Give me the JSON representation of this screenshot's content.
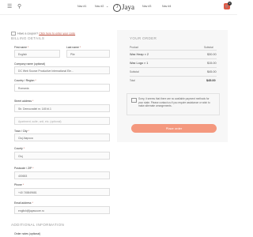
{
  "header": {
    "nav": [
      "Nav #1",
      "Nav #2",
      "Nav #3",
      "Nav #4"
    ],
    "logo": "Jaya",
    "cart_count": "0"
  },
  "coupon": {
    "prefix": "Have a coupon?",
    "link": "Click here to enter your code"
  },
  "billing": {
    "title": "BILLING DETAILS",
    "first_name": {
      "label": "First name",
      "value": "English"
    },
    "last_name": {
      "label": "Last name",
      "value": "Plie"
    },
    "company": {
      "label": "Company name (optional)",
      "value": "DC Web Source Productive International Ele..."
    },
    "country": {
      "label": "Country / Region",
      "value": "Romania"
    },
    "street": {
      "label": "Street address",
      "value": "Str. Democratiei nr. 145 bl.1",
      "placeholder2": "Apartment, suite, unit, etc. (optional)"
    },
    "city": {
      "label": "Town / City",
      "value": "Cluj-Napoca"
    },
    "county": {
      "label": "County",
      "value": "Cluj"
    },
    "postcode": {
      "label": "Postcode / ZIP",
      "value": "400653"
    },
    "phone": {
      "label": "Phone",
      "value": "+40 745849681"
    },
    "email": {
      "label": "Email address",
      "value": "english@jayasoure.ro"
    }
  },
  "additional": {
    "title": "ADDITIONAL INFORMATION",
    "notes_label": "Order notes (optional)"
  },
  "order": {
    "title": "YOUR ORDER",
    "col_product": "Product",
    "col_subtotal": "Subtotal",
    "items": [
      {
        "name": "Wax Heap × 2",
        "price": "$30.00"
      },
      {
        "name": "Wax Logo × 1",
        "price": "$15.00"
      }
    ],
    "subtotal_label": "Subtotal",
    "subtotal": "$45.00",
    "total_label": "Total",
    "total": "$45.00",
    "payment_notice": "Sorry, it seems that there are no available payment methods for your state. Please contact us if you require assistance or wish to make alternate arrangements.",
    "place_order": "Place order"
  },
  "colors": {
    "accent": "#f4987e",
    "link": "#c0594a",
    "cart": "#e05a45"
  }
}
